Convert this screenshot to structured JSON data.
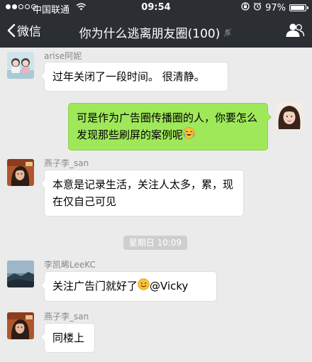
{
  "status_bar": {
    "carrier": "中国联通",
    "time": "09:54",
    "battery_text": "97%",
    "battery_level": 0.97
  },
  "nav": {
    "back_label": "微信",
    "title": "你为什么逃离朋友圈(100)"
  },
  "messages": [
    {
      "sender": "arise阿妮",
      "text": "过年关闭了一段时间。 很清静。"
    },
    {
      "text": "可是作为广告圈传播圈的人，你要怎么发现那些刷屏的案例呢"
    },
    {
      "sender": "燕子李_san",
      "text": "本意是记录生活，关注人太多，累，现在仅自己可见"
    },
    {
      "time": "星期日 10:09"
    },
    {
      "sender": "李凯晞LeeKC",
      "text": "关注广告门就好了",
      "mention": "@Vicky"
    },
    {
      "sender": "燕子李_san",
      "text": "同楼上"
    }
  ],
  "colors": {
    "header_bg": "#2b2f33",
    "chat_bg": "#ebebeb",
    "outgoing_bubble": "#9fe85a",
    "incoming_bubble": "#ffffff"
  }
}
